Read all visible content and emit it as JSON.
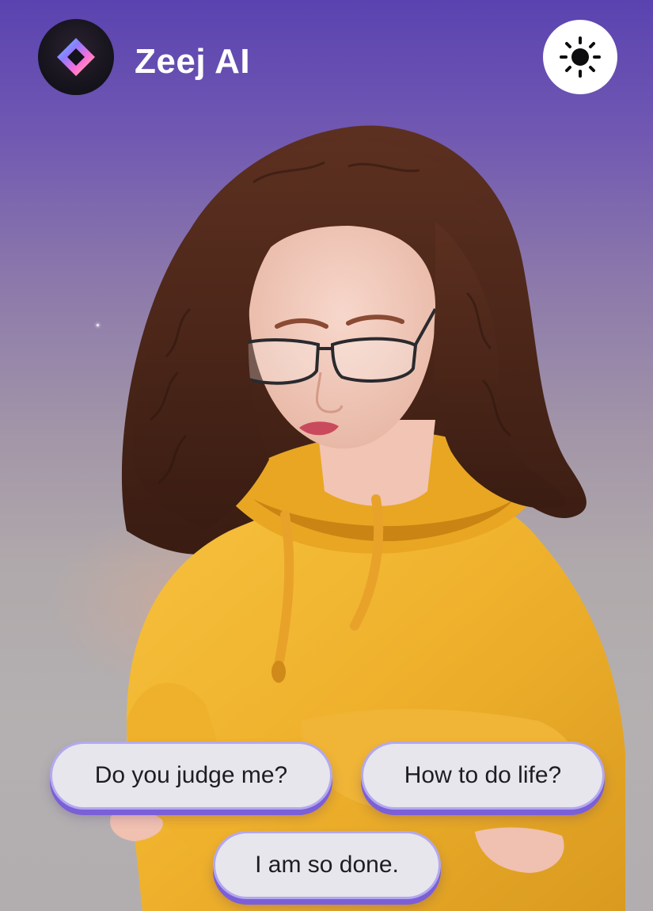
{
  "header": {
    "app_title": "Zeej AI",
    "logo_icon": "zeej-diamond-logo-icon",
    "theme_toggle_icon": "sun-icon"
  },
  "suggestions": [
    {
      "label": "Do you judge me?"
    },
    {
      "label": "How to do life?"
    },
    {
      "label": "I am so done."
    }
  ],
  "colors": {
    "background_top": "#5a43b0",
    "background_bottom": "#b2aeb0",
    "chip_fill": "#e6e6ec",
    "chip_shadow_accent": "#7b5fd8",
    "hoodie": "#f2b530",
    "hair": "#4a2418"
  }
}
